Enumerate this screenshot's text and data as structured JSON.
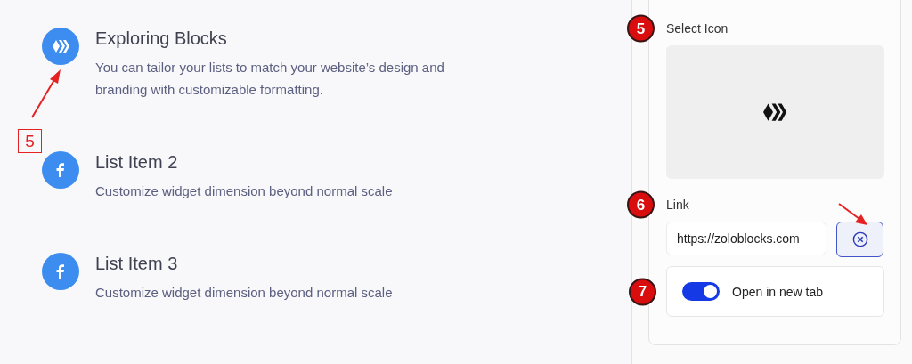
{
  "list_items": [
    {
      "kind": "hive",
      "title": "Exploring Blocks",
      "description": "You can tailor your lists to match your website’s design and branding with customizable formatting.",
      "marker": "5"
    },
    {
      "kind": "facebook",
      "title": "List Item 2",
      "description": "Customize widget dimension beyond normal scale"
    },
    {
      "kind": "facebook",
      "title": "List Item 3",
      "description": "Customize widget dimension beyond normal scale"
    }
  ],
  "settings": {
    "select_icon": {
      "label": "Select Icon",
      "kind": "hive",
      "marker": "5"
    },
    "link": {
      "label": "Link",
      "value": "https://zoloblocks.com",
      "marker": "6",
      "clear_arrow": true
    },
    "open_in_new_tab": {
      "label": "Open in new tab",
      "on": true,
      "marker": "7"
    }
  }
}
